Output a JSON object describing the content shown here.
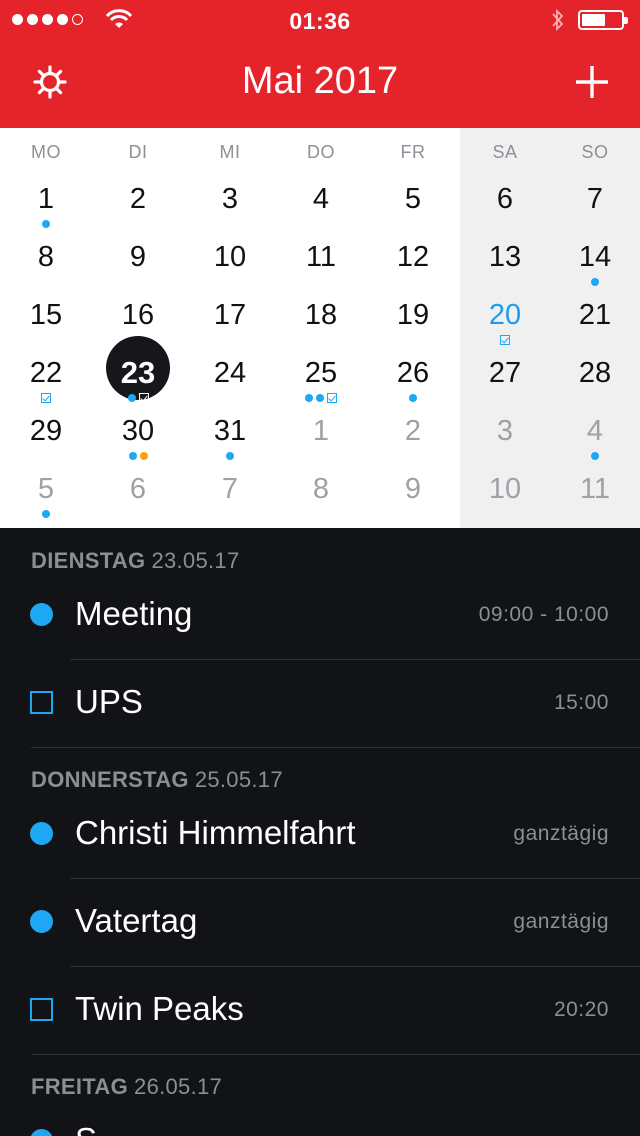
{
  "status_bar": {
    "time": "01:36",
    "signal_dots_filled": 4,
    "signal_dots_total": 5,
    "battery_level": 0.6
  },
  "header": {
    "title": "Mai 2017",
    "settings_icon": "gear-icon",
    "add_icon": "plus-icon"
  },
  "colors": {
    "header_red": "#e5232b",
    "event_blue": "#1ea7f2",
    "event_orange": "#ff9d0a",
    "agenda_bg": "#121316"
  },
  "calendar": {
    "weekdays": [
      "MO",
      "DI",
      "MI",
      "DO",
      "FR",
      "SA",
      "SO"
    ],
    "weeks": [
      [
        {
          "d": "1",
          "marks": [
            "dot"
          ]
        },
        {
          "d": "2"
        },
        {
          "d": "3"
        },
        {
          "d": "4"
        },
        {
          "d": "5"
        },
        {
          "d": "6"
        },
        {
          "d": "7"
        }
      ],
      [
        {
          "d": "8"
        },
        {
          "d": "9"
        },
        {
          "d": "10"
        },
        {
          "d": "11"
        },
        {
          "d": "12"
        },
        {
          "d": "13"
        },
        {
          "d": "14",
          "marks": [
            "dot"
          ]
        }
      ],
      [
        {
          "d": "15"
        },
        {
          "d": "16"
        },
        {
          "d": "17"
        },
        {
          "d": "18"
        },
        {
          "d": "19"
        },
        {
          "d": "20",
          "style": "blue",
          "marks": [
            "check"
          ]
        },
        {
          "d": "21"
        }
      ],
      [
        {
          "d": "22",
          "marks": [
            "check"
          ]
        },
        {
          "d": "23",
          "style": "today",
          "marks": [
            "dot",
            "check"
          ]
        },
        {
          "d": "24"
        },
        {
          "d": "25",
          "marks": [
            "dot",
            "dot",
            "check"
          ]
        },
        {
          "d": "26",
          "marks": [
            "dot"
          ]
        },
        {
          "d": "27"
        },
        {
          "d": "28"
        }
      ],
      [
        {
          "d": "29"
        },
        {
          "d": "30",
          "marks": [
            "dot",
            "orange"
          ]
        },
        {
          "d": "31",
          "marks": [
            "dot"
          ]
        },
        {
          "d": "1",
          "style": "muted"
        },
        {
          "d": "2",
          "style": "muted"
        },
        {
          "d": "3",
          "style": "muted"
        },
        {
          "d": "4",
          "style": "muted",
          "marks": [
            "dot"
          ]
        }
      ],
      [
        {
          "d": "5",
          "style": "muted",
          "marks": [
            "dot"
          ]
        },
        {
          "d": "6",
          "style": "muted"
        },
        {
          "d": "7",
          "style": "muted"
        },
        {
          "d": "8",
          "style": "muted"
        },
        {
          "d": "9",
          "style": "muted"
        },
        {
          "d": "10",
          "style": "muted"
        },
        {
          "d": "11",
          "style": "muted"
        }
      ]
    ]
  },
  "agenda": {
    "sections": [
      {
        "day": "DIENSTAG",
        "date": "23.05.17",
        "events": [
          {
            "type": "event",
            "title": "Meeting",
            "time": "09:00 - 10:00"
          },
          {
            "type": "task",
            "title": "UPS",
            "time": "15:00"
          }
        ]
      },
      {
        "day": "DONNERSTAG",
        "date": "25.05.17",
        "events": [
          {
            "type": "event",
            "title": "Christi Himmelfahrt",
            "time": "ganztägig"
          },
          {
            "type": "event",
            "title": "Vatertag",
            "time": "ganztägig"
          },
          {
            "type": "task",
            "title": "Twin Peaks",
            "time": "20:20"
          }
        ]
      },
      {
        "day": "FREITAG",
        "date": "26.05.17",
        "events": [
          {
            "type": "event",
            "title": "S",
            "time": ""
          }
        ]
      }
    ]
  }
}
